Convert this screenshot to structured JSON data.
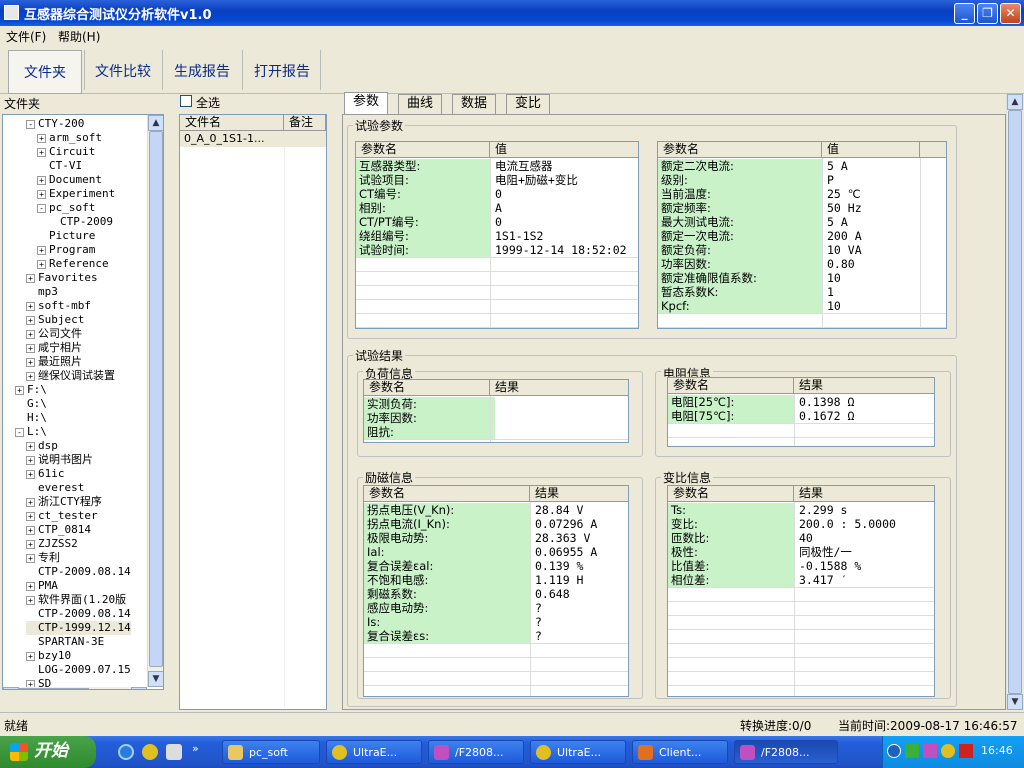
{
  "window": {
    "title": "互感器综合测试仪分析软件v1.0"
  },
  "menu": {
    "items": [
      "文件(F)",
      "帮助(H)"
    ]
  },
  "toolbar": {
    "items": [
      "文件夹",
      "文件比较",
      "生成报告",
      "打开报告"
    ]
  },
  "left": {
    "header": "文件夹"
  },
  "tree": [
    {
      "label": "CTY-200",
      "indent": 3,
      "pm": "-"
    },
    {
      "label": "arm_soft",
      "indent": 4,
      "pm": "+"
    },
    {
      "label": "Circuit",
      "indent": 4,
      "pm": "+"
    },
    {
      "label": "CT-VI",
      "indent": 4,
      "pm": ""
    },
    {
      "label": "Document",
      "indent": 4,
      "pm": "+"
    },
    {
      "label": "Experiment",
      "indent": 4,
      "pm": "+"
    },
    {
      "label": "pc_soft",
      "indent": 4,
      "pm": "-"
    },
    {
      "label": "CTP-2009",
      "indent": 5,
      "pm": ""
    },
    {
      "label": "Picture",
      "indent": 4,
      "pm": ""
    },
    {
      "label": "Program",
      "indent": 4,
      "pm": "+"
    },
    {
      "label": "Reference",
      "indent": 4,
      "pm": "+"
    },
    {
      "label": "Favorites",
      "indent": 3,
      "pm": "+"
    },
    {
      "label": "mp3",
      "indent": 3,
      "pm": ""
    },
    {
      "label": "soft-mbf",
      "indent": 3,
      "pm": "+"
    },
    {
      "label": "Subject",
      "indent": 3,
      "pm": "+"
    },
    {
      "label": "公司文件",
      "indent": 3,
      "pm": "+"
    },
    {
      "label": "咸宁相片",
      "indent": 3,
      "pm": "+"
    },
    {
      "label": "最近照片",
      "indent": 3,
      "pm": "+"
    },
    {
      "label": "继保仪调试装置",
      "indent": 3,
      "pm": "+"
    },
    {
      "label": "F:\\",
      "indent": 2,
      "pm": "+"
    },
    {
      "label": "G:\\",
      "indent": 2,
      "pm": ""
    },
    {
      "label": "H:\\",
      "indent": 2,
      "pm": ""
    },
    {
      "label": "L:\\",
      "indent": 2,
      "pm": "-"
    },
    {
      "label": "dsp",
      "indent": 3,
      "pm": "+"
    },
    {
      "label": "说明书图片",
      "indent": 3,
      "pm": "+"
    },
    {
      "label": "61ic",
      "indent": 3,
      "pm": "+"
    },
    {
      "label": "everest",
      "indent": 3,
      "pm": ""
    },
    {
      "label": "浙江CTY程序",
      "indent": 3,
      "pm": "+"
    },
    {
      "label": "ct_tester",
      "indent": 3,
      "pm": "+"
    },
    {
      "label": "CTP_0814",
      "indent": 3,
      "pm": "+"
    },
    {
      "label": "ZJZSS2",
      "indent": 3,
      "pm": "+"
    },
    {
      "label": "专利",
      "indent": 3,
      "pm": "+"
    },
    {
      "label": "CTP-2009.08.14",
      "indent": 3,
      "pm": ""
    },
    {
      "label": "PMA",
      "indent": 3,
      "pm": "+"
    },
    {
      "label": "软件界面(1.20版",
      "indent": 3,
      "pm": "+"
    },
    {
      "label": "CTP-2009.08.14",
      "indent": 3,
      "pm": ""
    },
    {
      "label": "CTP-1999.12.14",
      "indent": 3,
      "pm": "",
      "selected": true
    },
    {
      "label": "SPARTAN-3E",
      "indent": 3,
      "pm": ""
    },
    {
      "label": "bzy10",
      "indent": 3,
      "pm": "+"
    },
    {
      "label": "LOG-2009.07.15",
      "indent": 3,
      "pm": ""
    },
    {
      "label": "SD",
      "indent": 3,
      "pm": "+"
    }
  ],
  "files": {
    "select_all": "全选",
    "col_name": "文件名",
    "col_note": "备注",
    "rows": [
      "0_A_0_1S1-1..."
    ]
  },
  "tabs": [
    "参数",
    "曲线",
    "数据",
    "变比"
  ],
  "test_params": {
    "title": "试验参数",
    "col_name": "参数名",
    "col_value": "值",
    "left": [
      [
        "互感器类型:",
        "电流互感器"
      ],
      [
        "试验项目:",
        "电阻+励磁+变比"
      ],
      [
        "CT编号:",
        "0"
      ],
      [
        "相别:",
        "A"
      ],
      [
        "CT/PT编号:",
        "0"
      ],
      [
        "绕组编号:",
        "1S1-1S2"
      ],
      [
        "试验时间:",
        "1999-12-14 18:52:02"
      ]
    ],
    "right": [
      [
        "额定二次电流:",
        "5 A"
      ],
      [
        "级别:",
        "P"
      ],
      [
        "当前温度:",
        "25 ℃"
      ],
      [
        "额定频率:",
        "50 Hz"
      ],
      [
        "最大测试电流:",
        "5 A"
      ],
      [
        "额定一次电流:",
        "200 A"
      ],
      [
        "额定负荷:",
        "10 VA"
      ],
      [
        "功率因数:",
        "0.80"
      ],
      [
        "额定准确限值系数:",
        "10"
      ],
      [
        "暂态系数K:",
        "1"
      ],
      [
        "Kpcf:",
        "10"
      ]
    ]
  },
  "results": {
    "title": "试验结果",
    "col_name": "参数名",
    "col_result": "结果",
    "load": {
      "title": "负荷信息",
      "rows": [
        [
          "实测负荷:",
          ""
        ],
        [
          "功率因数:",
          ""
        ],
        [
          "阻抗:",
          ""
        ]
      ]
    },
    "resistance": {
      "title": "电阻信息",
      "rows": [
        [
          "电阻[25℃]:",
          "0.1398  Ω"
        ],
        [
          "电阻[75℃]:",
          "0.1672  Ω"
        ]
      ]
    },
    "excitation": {
      "title": "励磁信息",
      "rows": [
        [
          "拐点电压(V_Kn):",
          "28.84 V"
        ],
        [
          "拐点电流(I_Kn):",
          "0.07296 A"
        ],
        [
          "极限电动势:",
          "28.363 V"
        ],
        [
          "Ial:",
          "0.06955 A"
        ],
        [
          "复合误差εal:",
          "0.139 %"
        ],
        [
          "不饱和电感:",
          "1.119 H"
        ],
        [
          "剩磁系数:",
          "0.648"
        ],
        [
          "感应电动势:",
          "?"
        ],
        [
          "Is:",
          "?"
        ],
        [
          "复合误差εs:",
          "?"
        ]
      ]
    },
    "ratio": {
      "title": "变比信息",
      "rows": [
        [
          "Ts:",
          "2.299 s"
        ],
        [
          "变比:",
          "200.0 : 5.0000"
        ],
        [
          "匝数比:",
          "40"
        ],
        [
          "极性:",
          "同极性/一"
        ],
        [
          "比值差:",
          "-0.1588 %"
        ],
        [
          "相位差:",
          "3.417 ′"
        ]
      ]
    }
  },
  "status": {
    "left": "就绪",
    "progress": "转换进度:0/0",
    "time": "当前时间:2009-08-17 16:46:57"
  },
  "taskbar": {
    "start": "开始",
    "items": [
      "pc_soft",
      "UltraE...",
      "/F2808...",
      "UltraE...",
      "Client...",
      "/F2808..."
    ],
    "clock": "16:46"
  }
}
